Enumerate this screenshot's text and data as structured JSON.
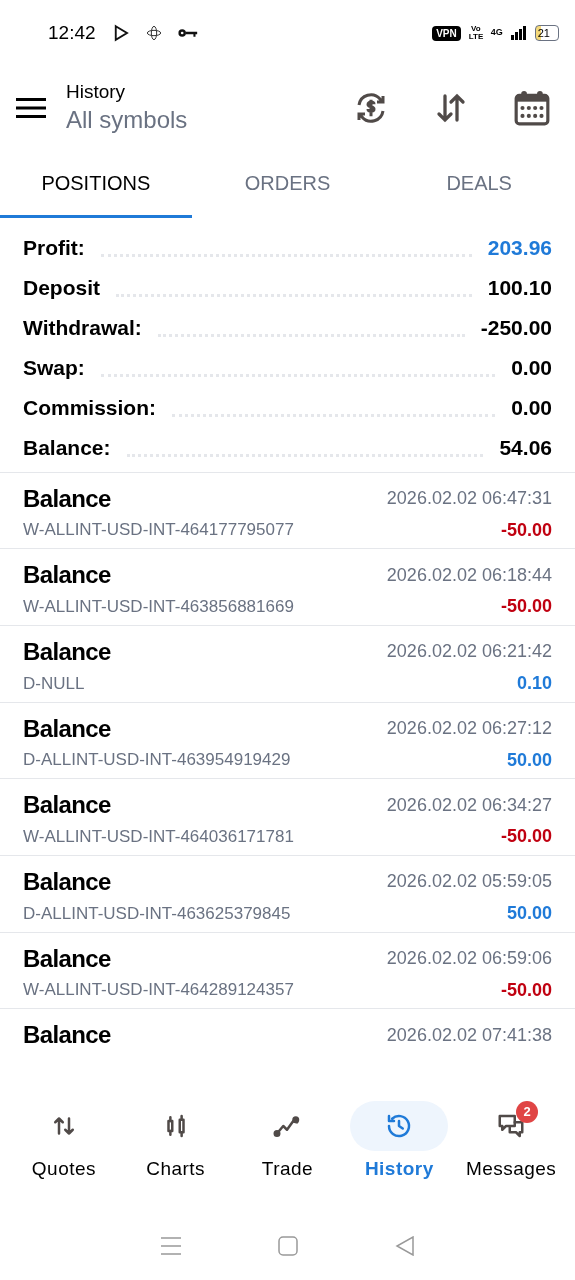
{
  "status_bar": {
    "time": "12:42",
    "vpn": "VPN",
    "volte": "Vo LTE",
    "network": "4G",
    "battery": "21"
  },
  "header": {
    "title": "History",
    "subtitle": "All symbols"
  },
  "tabs": [
    {
      "label": "POSITIONS",
      "selected": true
    },
    {
      "label": "ORDERS",
      "selected": false
    },
    {
      "label": "DEALS",
      "selected": false
    }
  ],
  "summary": [
    {
      "label": "Profit:",
      "value": "203.96",
      "highlight": true
    },
    {
      "label": "Deposit",
      "value": "100.10",
      "highlight": false
    },
    {
      "label": "Withdrawal:",
      "value": "-250.00",
      "highlight": false
    },
    {
      "label": "Swap:",
      "value": "0.00",
      "highlight": false
    },
    {
      "label": "Commission:",
      "value": "0.00",
      "highlight": false
    },
    {
      "label": "Balance:",
      "value": "54.06",
      "highlight": false
    }
  ],
  "deals": [
    {
      "title": "Balance",
      "time": "2026.02.02 06:47:31",
      "symbol": "W-ALLINT-USD-INT-464177795077",
      "amount": "-50.00",
      "kind": "negative"
    },
    {
      "title": "Balance",
      "time": "2026.02.02 06:18:44",
      "symbol": "W-ALLINT-USD-INT-463856881669",
      "amount": "-50.00",
      "kind": "negative"
    },
    {
      "title": "Balance",
      "time": "2026.02.02 06:21:42",
      "symbol": "D-NULL",
      "amount": "0.10",
      "kind": "positive"
    },
    {
      "title": "Balance",
      "time": "2026.02.02 06:27:12",
      "symbol": "D-ALLINT-USD-INT-463954919429",
      "amount": "50.00",
      "kind": "positive"
    },
    {
      "title": "Balance",
      "time": "2026.02.02 06:34:27",
      "symbol": "W-ALLINT-USD-INT-464036171781",
      "amount": "-50.00",
      "kind": "negative"
    },
    {
      "title": "Balance",
      "time": "2026.02.02 05:59:05",
      "symbol": "D-ALLINT-USD-INT-463625379845",
      "amount": "50.00",
      "kind": "positive"
    },
    {
      "title": "Balance",
      "time": "2026.02.02 06:59:06",
      "symbol": "W-ALLINT-USD-INT-464289124357",
      "amount": "-50.00",
      "kind": "negative"
    },
    {
      "title": "Balance",
      "time": "2026.02.02 07:41:38"
    }
  ],
  "bottom_nav": [
    {
      "label": "Quotes",
      "kind": "quotes",
      "selected": false
    },
    {
      "label": "Charts",
      "kind": "charts",
      "selected": false
    },
    {
      "label": "Trade",
      "kind": "trade",
      "selected": false
    },
    {
      "label": "History",
      "kind": "history",
      "selected": true
    },
    {
      "label": "Messages",
      "kind": "messages",
      "selected": false,
      "badge": "2"
    }
  ]
}
